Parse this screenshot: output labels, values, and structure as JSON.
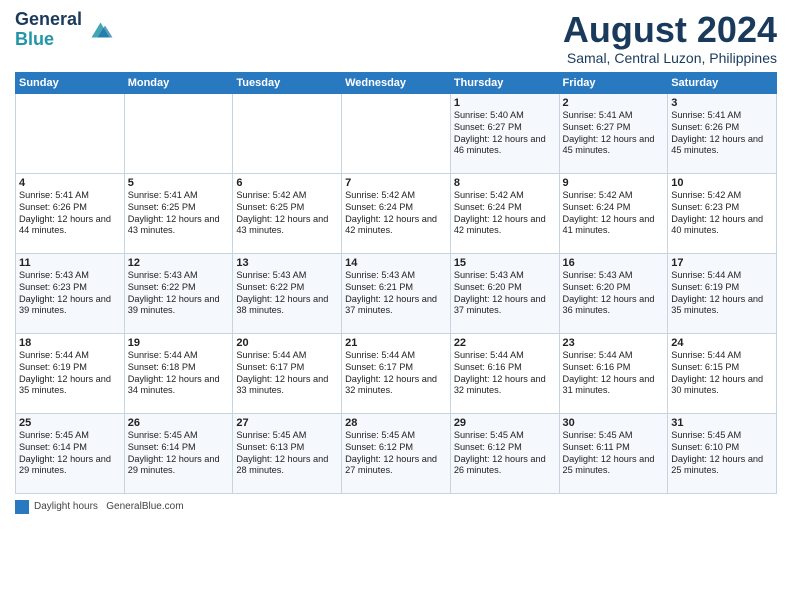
{
  "header": {
    "logo_line1": "General",
    "logo_line2": "Blue",
    "month": "August 2024",
    "location": "Samal, Central Luzon, Philippines"
  },
  "days_of_week": [
    "Sunday",
    "Monday",
    "Tuesday",
    "Wednesday",
    "Thursday",
    "Friday",
    "Saturday"
  ],
  "weeks": [
    [
      {
        "day": "",
        "info": ""
      },
      {
        "day": "",
        "info": ""
      },
      {
        "day": "",
        "info": ""
      },
      {
        "day": "",
        "info": ""
      },
      {
        "day": "1",
        "info": "Sunrise: 5:40 AM\nSunset: 6:27 PM\nDaylight: 12 hours and 46 minutes."
      },
      {
        "day": "2",
        "info": "Sunrise: 5:41 AM\nSunset: 6:27 PM\nDaylight: 12 hours and 45 minutes."
      },
      {
        "day": "3",
        "info": "Sunrise: 5:41 AM\nSunset: 6:26 PM\nDaylight: 12 hours and 45 minutes."
      }
    ],
    [
      {
        "day": "4",
        "info": "Sunrise: 5:41 AM\nSunset: 6:26 PM\nDaylight: 12 hours and 44 minutes."
      },
      {
        "day": "5",
        "info": "Sunrise: 5:41 AM\nSunset: 6:25 PM\nDaylight: 12 hours and 43 minutes."
      },
      {
        "day": "6",
        "info": "Sunrise: 5:42 AM\nSunset: 6:25 PM\nDaylight: 12 hours and 43 minutes."
      },
      {
        "day": "7",
        "info": "Sunrise: 5:42 AM\nSunset: 6:24 PM\nDaylight: 12 hours and 42 minutes."
      },
      {
        "day": "8",
        "info": "Sunrise: 5:42 AM\nSunset: 6:24 PM\nDaylight: 12 hours and 42 minutes."
      },
      {
        "day": "9",
        "info": "Sunrise: 5:42 AM\nSunset: 6:24 PM\nDaylight: 12 hours and 41 minutes."
      },
      {
        "day": "10",
        "info": "Sunrise: 5:42 AM\nSunset: 6:23 PM\nDaylight: 12 hours and 40 minutes."
      }
    ],
    [
      {
        "day": "11",
        "info": "Sunrise: 5:43 AM\nSunset: 6:23 PM\nDaylight: 12 hours and 39 minutes."
      },
      {
        "day": "12",
        "info": "Sunrise: 5:43 AM\nSunset: 6:22 PM\nDaylight: 12 hours and 39 minutes."
      },
      {
        "day": "13",
        "info": "Sunrise: 5:43 AM\nSunset: 6:22 PM\nDaylight: 12 hours and 38 minutes."
      },
      {
        "day": "14",
        "info": "Sunrise: 5:43 AM\nSunset: 6:21 PM\nDaylight: 12 hours and 37 minutes."
      },
      {
        "day": "15",
        "info": "Sunrise: 5:43 AM\nSunset: 6:20 PM\nDaylight: 12 hours and 37 minutes."
      },
      {
        "day": "16",
        "info": "Sunrise: 5:43 AM\nSunset: 6:20 PM\nDaylight: 12 hours and 36 minutes."
      },
      {
        "day": "17",
        "info": "Sunrise: 5:44 AM\nSunset: 6:19 PM\nDaylight: 12 hours and 35 minutes."
      }
    ],
    [
      {
        "day": "18",
        "info": "Sunrise: 5:44 AM\nSunset: 6:19 PM\nDaylight: 12 hours and 35 minutes."
      },
      {
        "day": "19",
        "info": "Sunrise: 5:44 AM\nSunset: 6:18 PM\nDaylight: 12 hours and 34 minutes."
      },
      {
        "day": "20",
        "info": "Sunrise: 5:44 AM\nSunset: 6:17 PM\nDaylight: 12 hours and 33 minutes."
      },
      {
        "day": "21",
        "info": "Sunrise: 5:44 AM\nSunset: 6:17 PM\nDaylight: 12 hours and 32 minutes."
      },
      {
        "day": "22",
        "info": "Sunrise: 5:44 AM\nSunset: 6:16 PM\nDaylight: 12 hours and 32 minutes."
      },
      {
        "day": "23",
        "info": "Sunrise: 5:44 AM\nSunset: 6:16 PM\nDaylight: 12 hours and 31 minutes."
      },
      {
        "day": "24",
        "info": "Sunrise: 5:44 AM\nSunset: 6:15 PM\nDaylight: 12 hours and 30 minutes."
      }
    ],
    [
      {
        "day": "25",
        "info": "Sunrise: 5:45 AM\nSunset: 6:14 PM\nDaylight: 12 hours and 29 minutes."
      },
      {
        "day": "26",
        "info": "Sunrise: 5:45 AM\nSunset: 6:14 PM\nDaylight: 12 hours and 29 minutes."
      },
      {
        "day": "27",
        "info": "Sunrise: 5:45 AM\nSunset: 6:13 PM\nDaylight: 12 hours and 28 minutes."
      },
      {
        "day": "28",
        "info": "Sunrise: 5:45 AM\nSunset: 6:12 PM\nDaylight: 12 hours and 27 minutes."
      },
      {
        "day": "29",
        "info": "Sunrise: 5:45 AM\nSunset: 6:12 PM\nDaylight: 12 hours and 26 minutes."
      },
      {
        "day": "30",
        "info": "Sunrise: 5:45 AM\nSunset: 6:11 PM\nDaylight: 12 hours and 25 minutes."
      },
      {
        "day": "31",
        "info": "Sunrise: 5:45 AM\nSunset: 6:10 PM\nDaylight: 12 hours and 25 minutes."
      }
    ]
  ],
  "footer": {
    "legend_label": "Daylight hours",
    "credit": "GeneralBlue.com"
  }
}
